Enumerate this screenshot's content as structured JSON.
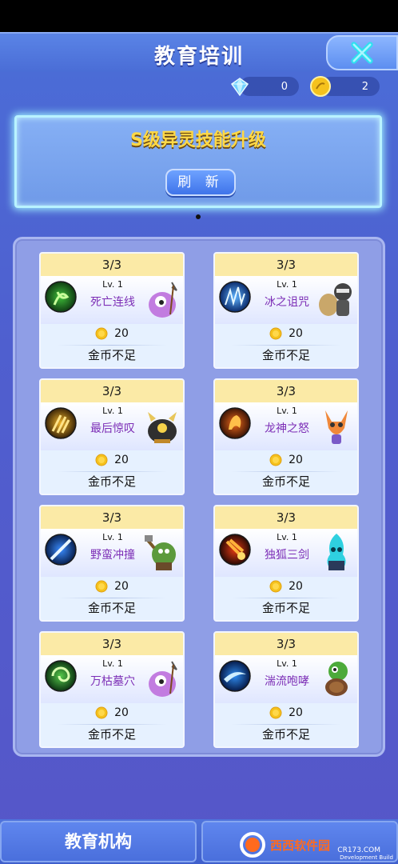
{
  "header": {
    "title": "教育培训"
  },
  "currency": {
    "gems": "0",
    "coins": "2"
  },
  "banner": {
    "title": "S级异灵技能升级",
    "refresh_label": "刷 新"
  },
  "cards": [
    {
      "count": "3/3",
      "level": "Lv. 1",
      "skill": "死亡连线",
      "cost": "20",
      "status": "金币不足",
      "icon": "green-wind",
      "pet": "purple-blob"
    },
    {
      "count": "3/3",
      "level": "Lv. 1",
      "skill": "冰之诅咒",
      "cost": "20",
      "status": "金币不足",
      "icon": "ice-spikes",
      "pet": "ninja-sack"
    },
    {
      "count": "3/3",
      "level": "Lv. 1",
      "skill": "最后惊叹",
      "cost": "20",
      "status": "金币不足",
      "icon": "golden-claws",
      "pet": "horned-beast"
    },
    {
      "count": "3/3",
      "level": "Lv. 1",
      "skill": "龙神之怒",
      "cost": "20",
      "status": "金币不足",
      "icon": "fire-dragon",
      "pet": "fox-spirit"
    },
    {
      "count": "3/3",
      "level": "Lv. 1",
      "skill": "野蛮冲撞",
      "cost": "20",
      "status": "金币不足",
      "icon": "blue-slash",
      "pet": "goblin-warrior"
    },
    {
      "count": "3/3",
      "level": "Lv. 1",
      "skill": "独狐三剑",
      "cost": "20",
      "status": "金币不足",
      "icon": "meteor-fire",
      "pet": "ghost-flame"
    },
    {
      "count": "3/3",
      "level": "Lv. 1",
      "skill": "万枯墓穴",
      "cost": "20",
      "status": "金币不足",
      "icon": "green-vortex",
      "pet": "purple-blob"
    },
    {
      "count": "3/3",
      "level": "Lv. 1",
      "skill": "湍流咆哮",
      "cost": "20",
      "status": "金币不足",
      "icon": "blue-storm",
      "pet": "green-turtle"
    }
  ],
  "bottom_tabs": {
    "tab1": "教育机构",
    "tab2": ""
  },
  "watermark": {
    "text": "西西软件园",
    "sub": "CR173.COM",
    "dev": "Development Build"
  }
}
